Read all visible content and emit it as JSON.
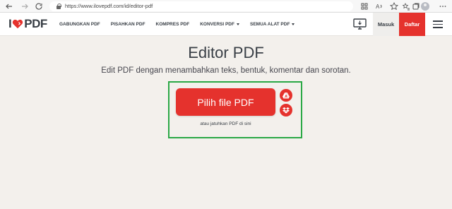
{
  "browser": {
    "url": "https://www.ilovepdf.com/id/editor-pdf",
    "icons": [
      "back-icon",
      "forward-icon",
      "refresh-icon",
      "lock-icon",
      "apps-icon",
      "read-aloud-icon",
      "favorites-icon",
      "favorites-bar-icon",
      "collections-icon",
      "profile-icon",
      "more-icon"
    ]
  },
  "header": {
    "logo": {
      "prefix": "I",
      "suffix": "PDF"
    },
    "menu": [
      {
        "label": "GABUNGKAN PDF",
        "dropdown": false
      },
      {
        "label": "PISAHKAN PDF",
        "dropdown": false
      },
      {
        "label": "KOMPRES PDF",
        "dropdown": false
      },
      {
        "label": "KONVERSI PDF",
        "dropdown": true
      },
      {
        "label": "SEMUA ALAT PDF",
        "dropdown": true
      }
    ],
    "login_label": "Masuk",
    "signup_label": "Daftar"
  },
  "main": {
    "title": "Editor PDF",
    "subtitle": "Edit PDF dengan menambahkan teks, bentuk, komentar dan sorotan.",
    "select_button_label": "Pilih file PDF",
    "drop_hint": "atau jatuhkan PDF di sini",
    "cloud_sources": [
      "google-drive-icon",
      "dropbox-icon"
    ]
  },
  "colors": {
    "brand_red": "#e5322d",
    "text_dark": "#383e45",
    "background": "#f3f0ec",
    "highlight_green": "#2aa845"
  }
}
